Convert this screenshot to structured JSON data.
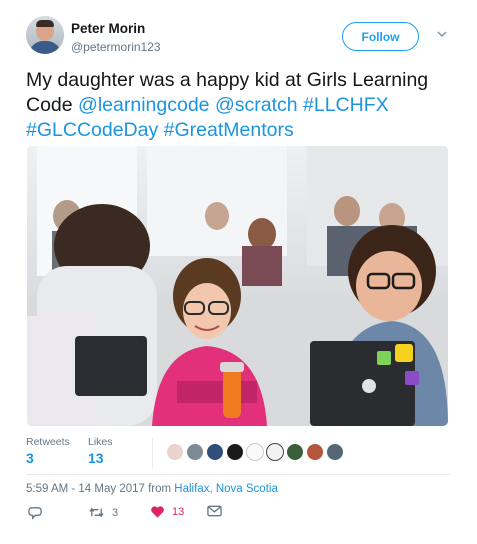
{
  "user": {
    "name": "Peter Morin",
    "handle": "@petermorin123"
  },
  "follow_label": "Follow",
  "tweet": {
    "text_plain": "My daughter was a happy kid at Girls Learning Code ",
    "mention_1": "@learningcode",
    "mention_2": "@scratch",
    "hashtag_1": "#LLCHFX",
    "hashtag_2": "#GLCCodeDay",
    "hashtag_3": "#GreatMentors"
  },
  "stats": {
    "retweets_label": "Retweets",
    "retweets_count": "3",
    "likes_label": "Likes",
    "likes_count": "13"
  },
  "timestamp": {
    "time_date": "5:59 AM - 14 May 2017 from ",
    "place": "Halifax, Nova Scotia"
  },
  "actions": {
    "retweet_count": "3",
    "like_count": "13"
  },
  "colors": {
    "link": "#1b95e0",
    "like": "#e0245e",
    "muted": "#657786"
  }
}
